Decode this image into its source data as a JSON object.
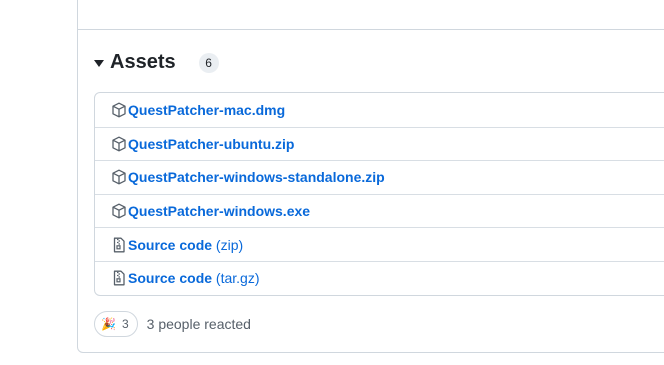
{
  "assets": {
    "title": "Assets",
    "count": "6",
    "items": [
      {
        "name": "QuestPatcher-mac.dmg",
        "suffix": "",
        "icon": "package-icon"
      },
      {
        "name": "QuestPatcher-ubuntu.zip",
        "suffix": "",
        "icon": "package-icon"
      },
      {
        "name": "QuestPatcher-windows-standalone.zip",
        "suffix": "",
        "icon": "package-icon"
      },
      {
        "name": "QuestPatcher-windows.exe",
        "suffix": "",
        "icon": "package-icon"
      },
      {
        "name": "Source code",
        "suffix": "(zip)",
        "icon": "file-zip-icon"
      },
      {
        "name": "Source code",
        "suffix": "(tar.gz)",
        "icon": "file-zip-icon"
      }
    ]
  },
  "reactions": {
    "emoji": "🎉",
    "count": "3",
    "summary": "3 people reacted"
  },
  "colors": {
    "link": "#0969da",
    "border": "#d0d7de",
    "muted": "#57606a"
  }
}
